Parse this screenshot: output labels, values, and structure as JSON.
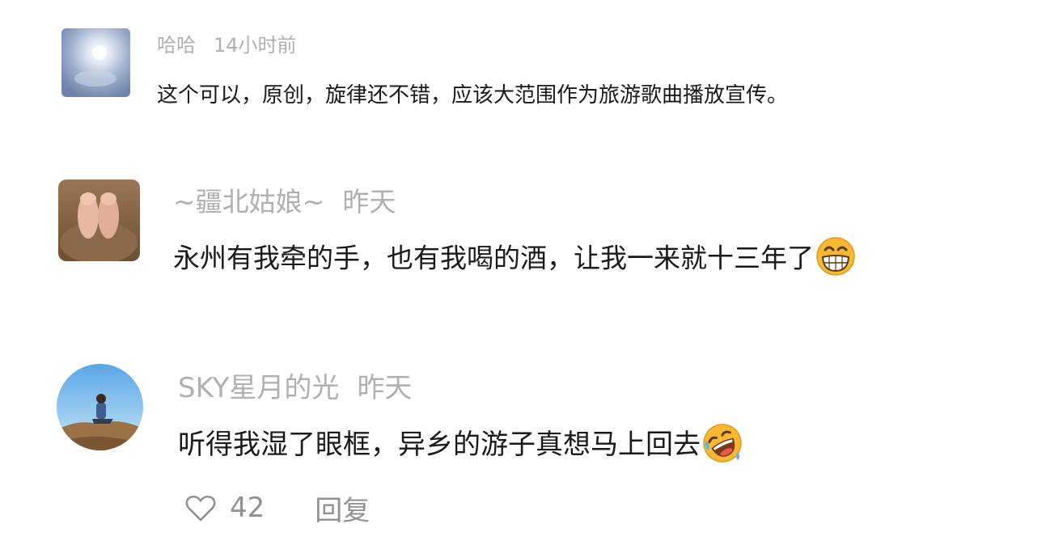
{
  "comments": [
    {
      "username": "哈哈",
      "time": "14小时前",
      "text": "这个可以，原创，旋律还不错，应该大范围作为旅游歌曲播放宣传。"
    },
    {
      "username": "~疆北姑娘~",
      "time": "昨天",
      "text": "永州有我牵的手，也有我喝的酒，让我一来就十三年了",
      "emoji": "grinning-face-emoji"
    },
    {
      "username": "SKY星月的光",
      "time": "昨天",
      "text": "听得我湿了眼框，异乡的游子真想马上回去",
      "emoji": "rolling-on-floor-laughing-emoji",
      "likes": "42",
      "reply_label": "回复"
    }
  ],
  "icons": {
    "like": "heart-outline-icon"
  },
  "colors": {
    "meta_text": "#aeb0b4",
    "body_text": "#1a1a1a",
    "action_text": "#8f9194",
    "emoji_yellow": "#f7b933"
  }
}
